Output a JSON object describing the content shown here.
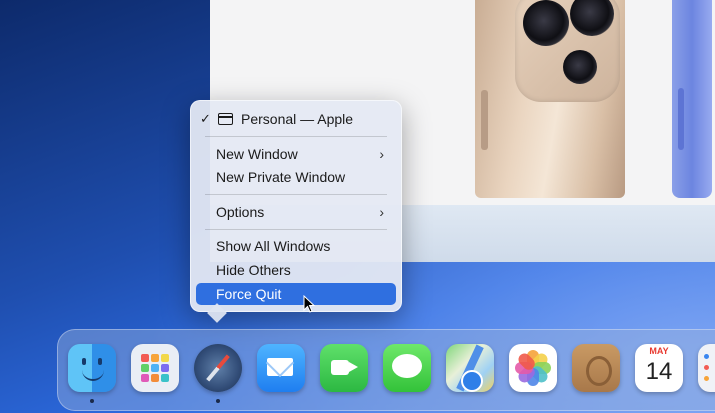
{
  "context_menu": {
    "window_item": {
      "check": "✓",
      "label": "Personal — Apple"
    },
    "items": [
      {
        "label": "New Window",
        "has_submenu": true
      },
      {
        "label": "New Private Window",
        "has_submenu": false
      },
      {
        "label": "Options",
        "has_submenu": true
      },
      {
        "label": "Show All Windows",
        "has_submenu": false
      },
      {
        "label": "Hide Others",
        "has_submenu": false
      },
      {
        "label": "Force Quit",
        "has_submenu": false,
        "selected": true
      }
    ],
    "submenu_glyph": "›",
    "accent_color": "#2f6fe0"
  },
  "dock": {
    "apps": [
      {
        "name": "finder-icon",
        "running": true
      },
      {
        "name": "launchpad-icon",
        "running": false
      },
      {
        "name": "safari-icon",
        "running": true
      },
      {
        "name": "mail-icon",
        "running": false
      },
      {
        "name": "facetime-icon",
        "running": false
      },
      {
        "name": "messages-icon",
        "running": false
      },
      {
        "name": "maps-icon",
        "running": false
      },
      {
        "name": "photos-icon",
        "running": false
      },
      {
        "name": "contacts-icon",
        "running": false
      },
      {
        "name": "calendar-icon",
        "running": false
      }
    ],
    "calendar": {
      "month": "MAY",
      "day": "14"
    }
  }
}
